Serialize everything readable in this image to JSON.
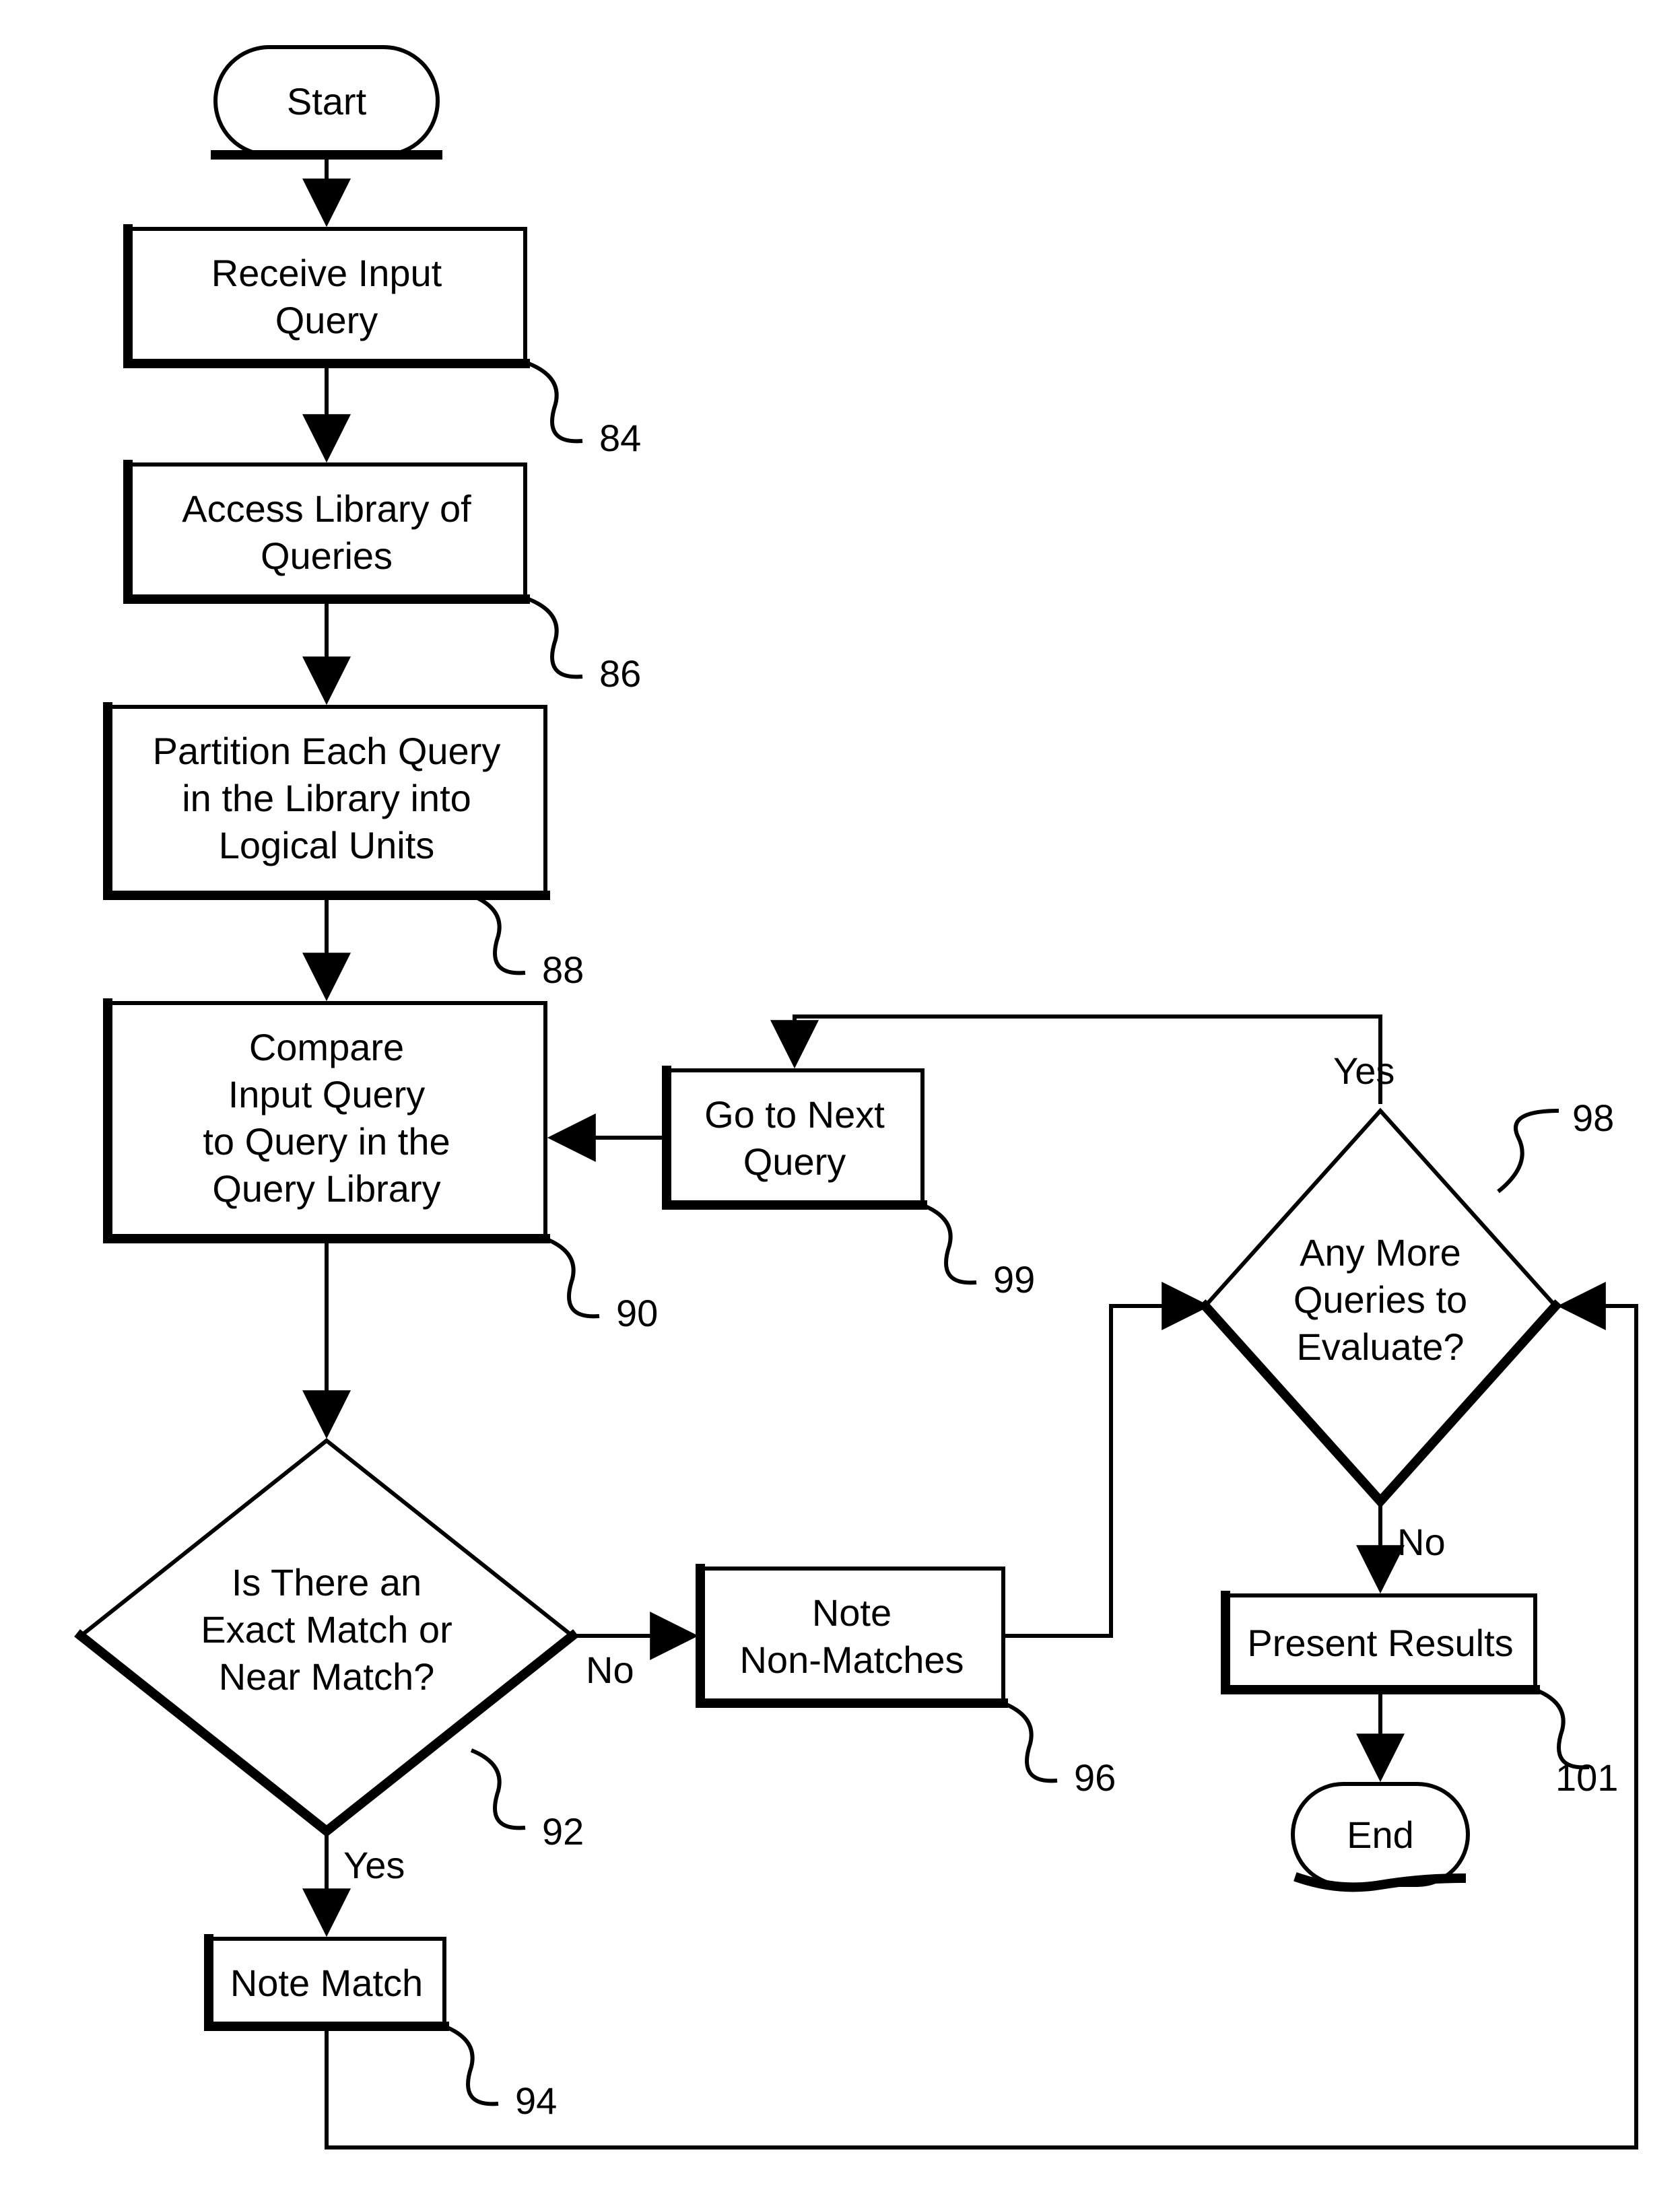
{
  "nodes": {
    "start": "Start",
    "end": "End",
    "receive": {
      "l1": "Receive Input",
      "l2": "Query"
    },
    "access": {
      "l1": "Access Library of",
      "l2": "Queries"
    },
    "partition": {
      "l1": "Partition Each Query",
      "l2": "in the Library into",
      "l3": "Logical Units"
    },
    "compare": {
      "l1": "Compare",
      "l2": "Input Query",
      "l3": "to Query in the",
      "l4": "Query Library"
    },
    "gotonext": {
      "l1": "Go to Next",
      "l2": "Query"
    },
    "decision_match": {
      "l1": "Is There an",
      "l2": "Exact Match or",
      "l3": "Near Match?"
    },
    "note_nonmatch": {
      "l1": "Note",
      "l2": "Non-Matches"
    },
    "decision_more": {
      "l1": "Any More",
      "l2": "Queries to",
      "l3": "Evaluate?"
    },
    "present": "Present Results",
    "note_match": "Note Match"
  },
  "edge_labels": {
    "yes1": "Yes",
    "no1": "No",
    "yes2": "Yes",
    "no2": "No"
  },
  "ref_nums": {
    "n84": "84",
    "n86": "86",
    "n88": "88",
    "n90": "90",
    "n92": "92",
    "n94": "94",
    "n96": "96",
    "n98": "98",
    "n99": "99",
    "n101": "101"
  }
}
